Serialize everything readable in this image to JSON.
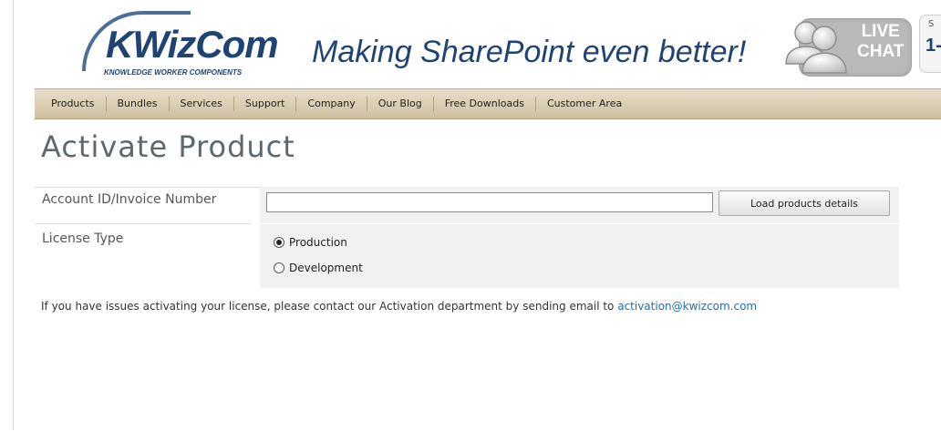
{
  "header": {
    "logo_text": "KWizCom",
    "logo_subtitle": "KNOWLEDGE WORKER COMPONENTS",
    "tagline": "Making SharePoint even better!",
    "live_chat": {
      "line1": "LIVE",
      "line2": "CHAT"
    },
    "phone_prefix": "S",
    "phone_digit": "1-"
  },
  "nav": {
    "items": [
      "Products",
      "Bundles",
      "Services",
      "Support",
      "Company",
      "Our Blog",
      "Free Downloads",
      "Customer Area"
    ]
  },
  "main": {
    "title": "Activate Product",
    "account_label": "Account ID/Invoice Number",
    "account_value": "",
    "load_button": "Load products details",
    "license_label": "License Type",
    "license_options": [
      {
        "label": "Production",
        "selected": true
      },
      {
        "label": "Development",
        "selected": false
      }
    ],
    "help_text": "If you have issues activating your license, please contact our Activation department by sending email to ",
    "help_email": "activation@kwizcom.com"
  },
  "colors": {
    "brand_blue": "#1f4374",
    "link_blue": "#1c6fb8",
    "nav_tan": "#d9cdb3",
    "title_gray": "#5c6870"
  },
  "icons": [
    "live-chat-people-icon",
    "radio-checked-icon",
    "radio-unchecked-icon"
  ]
}
